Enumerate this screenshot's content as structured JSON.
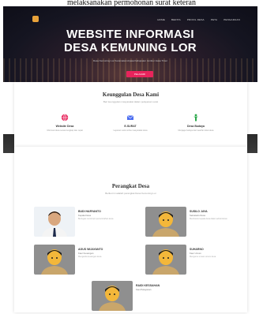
{
  "caption": "melaksanakan permohonan surat keteran",
  "nav": {
    "items": [
      "HOME",
      "BERITA",
      "PROFIL DESA",
      "PETA",
      "PENGADUAN"
    ]
  },
  "hero": {
    "title_line1": "WEBSITE INFORMASI",
    "title_line2": "DESA KEMUNING LOR",
    "subtitle": "Desa Kemuning Lor Kecamatan Arjasa Kabupaten Jember Jawa Timur",
    "button_label": "PELAJARI"
  },
  "features_section": {
    "title": "Keunggulan Desa Kami",
    "subtitle": "Beri keunggulan masyarakat dalam pelayanan surat",
    "items": [
      {
        "icon": "globe-icon",
        "title": "Website Desa",
        "desc": "Informasi desa secara lengkap dan cepat"
      },
      {
        "icon": "mail-icon",
        "title": "E-SURAT",
        "desc": "Layanan surat online masyarakat desa"
      },
      {
        "icon": "figure-icon",
        "title": "Desa Budaya",
        "desc": "Menjaga budaya dan kearifan lokal desa"
      }
    ],
    "colors": {
      "globe": "#e8245c",
      "mail": "#4a6cf0",
      "figure": "#2aa84a"
    }
  },
  "staff_section": {
    "title": "Perangkat Desa",
    "subtitle": "Berikut ini adalah perangkat Desa Kemuning Lor",
    "people": [
      {
        "name": "BUDI HARYANTO",
        "role": "Kepala Desa",
        "desc": "Bertugas memimpin pemerintahan desa"
      },
      {
        "name": "SUSILO JAYA",
        "role": "Sekretaris Desa",
        "desc": "Membantu kepala desa dalam administrasi"
      },
      {
        "name": "AGUS WIJAYANTO",
        "role": "Kaur Keuangan",
        "desc": "Mengelola keuangan desa"
      },
      {
        "name": "SUHARNO",
        "role": "Kaur Umum",
        "desc": "Mengurus urusan umum desa"
      },
      {
        "name": "RAIDI KESSAHAN",
        "role": "Kasi Pelayanan",
        "desc": ""
      }
    ]
  }
}
